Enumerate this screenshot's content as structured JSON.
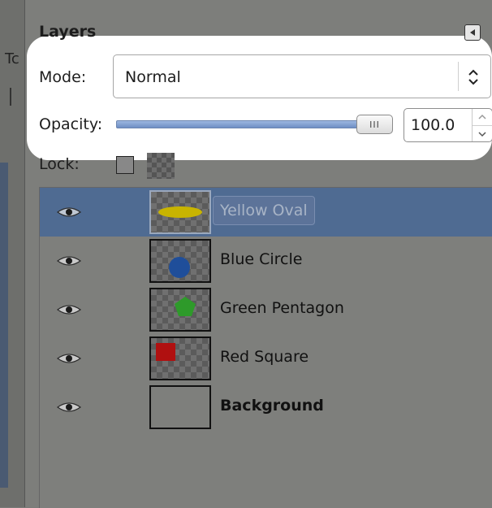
{
  "panel": {
    "title": "Layers",
    "menu_icon": "triangle-left-icon"
  },
  "mode": {
    "label": "Mode:",
    "value": "Normal"
  },
  "opacity": {
    "label": "Opacity:",
    "value": "100.0",
    "slider_fraction": 1.0,
    "thumb_grip": "III"
  },
  "lock": {
    "label": "Lock:"
  },
  "layers": [
    {
      "name": "Yellow Oval",
      "selected": true,
      "shape": "oval",
      "color": "#c8b400"
    },
    {
      "name": "Blue Circle",
      "selected": false,
      "shape": "circle",
      "color": "#1f4e9a"
    },
    {
      "name": "Green Pentagon",
      "selected": false,
      "shape": "pentagon",
      "color": "#2e9a2a"
    },
    {
      "name": "Red Square",
      "selected": false,
      "shape": "square",
      "color": "#b01010"
    },
    {
      "name": "Background",
      "selected": false,
      "shape": "none",
      "color": "#7e7f7c"
    }
  ],
  "colors": {
    "selection": "#4f6b92",
    "slider": "#7d9ad0"
  }
}
